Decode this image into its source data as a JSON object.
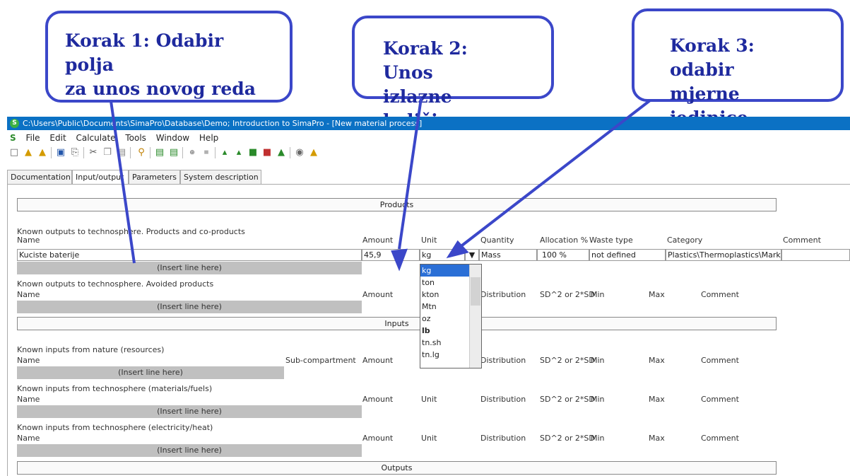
{
  "callouts": {
    "step1": [
      "Korak 1: Odabir polja",
      "za unos novog reda"
    ],
    "step2": [
      "Korak 2: Unos",
      "izlazne količine"
    ],
    "step3": [
      "Korak 3: odabir",
      "mjerne jedinice"
    ]
  },
  "window": {
    "title": "C:\\Users\\Public\\Documents\\SimaPro\\Database\\Demo; Introduction to SimaPro - [New material process]",
    "logo": "S"
  },
  "menu": [
    "S",
    "File",
    "Edit",
    "Calculate",
    "Tools",
    "Window",
    "Help"
  ],
  "tabs": [
    "Documentation",
    "Input/output",
    "Parameters",
    "System description"
  ],
  "sections": {
    "products": "Products",
    "inputs": "Inputs",
    "outputs": "Outputs"
  },
  "products": {
    "header": "Known outputs to technosphere. Products and co-products",
    "columns": [
      "Name",
      "Amount",
      "Unit",
      "Quantity",
      "Allocation %",
      "Waste type",
      "Category",
      "Comment"
    ],
    "row": {
      "name": "Kuciste baterije",
      "amount": "45,9",
      "unit": "kg",
      "quantity": "Mass",
      "allocation": "100 %",
      "waste_type": "not defined",
      "category": "Plastics\\Thermoplastics\\Market"
    },
    "insert": "(Insert line here)"
  },
  "avoided": {
    "header": "Known outputs to technosphere. Avoided products",
    "columns": [
      "Name",
      "Amount",
      "Distribution",
      "SD^2 or 2*SD",
      "Min",
      "Max",
      "Comment"
    ],
    "insert": "(Insert line here)"
  },
  "resources": {
    "header": "Known inputs from nature (resources)",
    "columns": [
      "Name",
      "Sub-compartment",
      "Amount",
      "Distribution",
      "SD^2 or 2*SD",
      "Min",
      "Max",
      "Comment"
    ],
    "insert": "(Insert line here)"
  },
  "materials": {
    "header": "Known inputs from technosphere (materials/fuels)",
    "columns": [
      "Name",
      "Amount",
      "Unit",
      "Distribution",
      "SD^2 or 2*SD",
      "Min",
      "Max",
      "Comment"
    ],
    "insert": "(Insert line here)"
  },
  "electricity": {
    "header": "Known inputs from technosphere (electricity/heat)",
    "columns": [
      "Name",
      "Amount",
      "Unit",
      "Distribution",
      "SD^2 or 2*SD",
      "Min",
      "Max",
      "Comment"
    ],
    "insert": "(Insert line here)"
  },
  "unit_dropdown": {
    "options": [
      "kg",
      "ton",
      "kton",
      "Mtn",
      "oz",
      "lb",
      "tn.sh",
      "tn.lg"
    ],
    "selected": "kg"
  },
  "icons": {
    "new": "new-document-icon",
    "open": "open-folder-icon",
    "save": "save-icon",
    "print": "print-icon",
    "cut": "cut-icon",
    "copy": "copy-icon",
    "paste": "paste-icon",
    "find": "search-icon"
  },
  "colors": {
    "callout_border": "#3b47c9",
    "callout_text": "#1f2a9e",
    "titlebar": "#0b71c4",
    "dropdown_selected": "#2b6fd6"
  }
}
